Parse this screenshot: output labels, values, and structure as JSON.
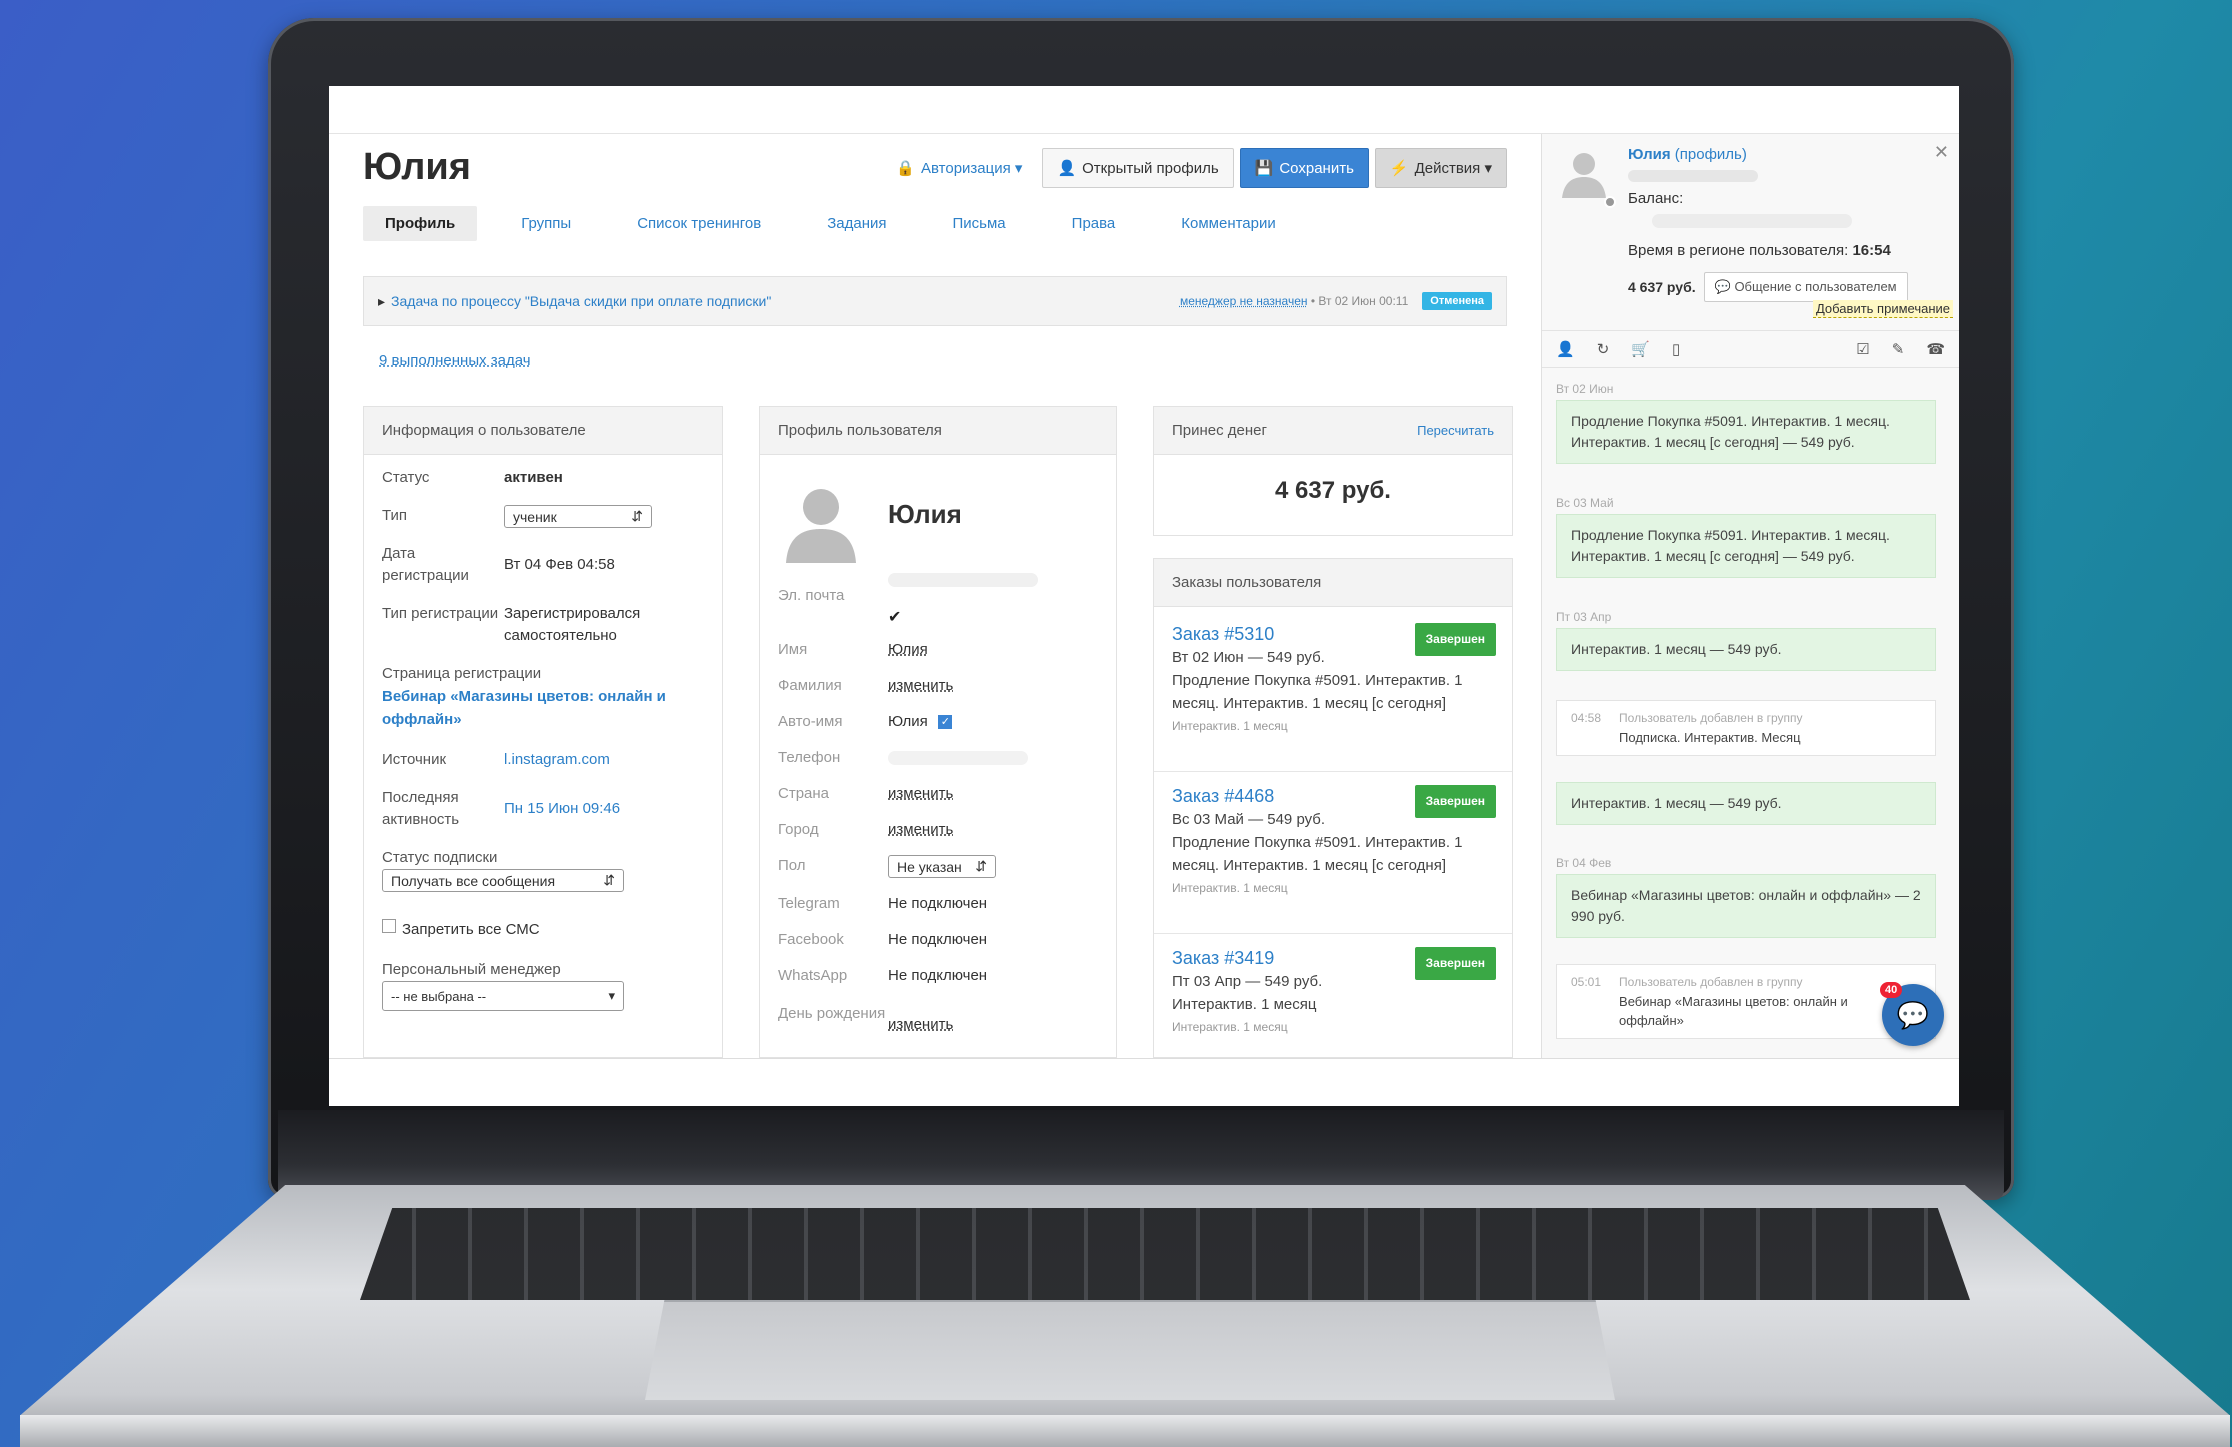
{
  "user": {
    "name": "Юлия"
  },
  "top_actions": {
    "auth": "Авторизация ▾",
    "open_profile": "Открытый профиль",
    "save": "Сохранить",
    "actions": "Действия ▾"
  },
  "tabs": [
    "Профиль",
    "Группы",
    "Список тренингов",
    "Задания",
    "Письма",
    "Права",
    "Комментарии"
  ],
  "task_bar": {
    "text": "Задача по процессу \"Выдача скидки при оплате подписки\"",
    "manager": "менеджер не назначен",
    "date": "• Вт 02 Июн 00:11",
    "status": "Отменена"
  },
  "done_tasks": "9 выполненных задач",
  "user_info": {
    "title": "Информация о пользователе",
    "status_label": "Статус",
    "status": "активен",
    "type_label": "Тип",
    "type": "ученик",
    "reg_date_label": "Дата регистрации",
    "reg_date": "Вт 04 Фев 04:58",
    "reg_type_label": "Тип регистрации",
    "reg_type": "Зарегистрировался самостоятельно",
    "reg_page_label": "Страница регистрации",
    "reg_page": "Вебинар «Магазины цветов: онлайн и оффлайн»",
    "source_label": "Источник",
    "source": "l.instagram.com",
    "last_activity_label": "Последняя активность",
    "last_activity": "Пн 15 Июн 09:46",
    "sub_status_label": "Статус подписки",
    "sub_status": "Получать все сообщения",
    "forbid_sms": "Запретить все СМС",
    "manager_label": "Персональный менеджер",
    "manager": "-- не выбрана --"
  },
  "user_profile": {
    "title": "Профиль пользователя",
    "name": "Юлия",
    "email_label": "Эл. почта",
    "first_name_label": "Имя",
    "first_name": "Юлия",
    "last_name_label": "Фамилия",
    "change": "изменить",
    "auto_name_label": "Авто-имя",
    "auto_name": "Юлия",
    "phone_label": "Телефон",
    "country_label": "Страна",
    "city_label": "Город",
    "gender_label": "Пол",
    "gender": "Не указан",
    "telegram_label": "Telegram",
    "telegram": "Не подключен",
    "facebook_label": "Facebook",
    "facebook": "Не подключен",
    "whatsapp_label": "WhatsApp",
    "whatsapp": "Не подключен",
    "birthday_label": "День рождения"
  },
  "money": {
    "title": "Принес денег",
    "recalc": "Пересчитать",
    "amount": "4 637 руб."
  },
  "orders": {
    "title": "Заказы пользователя",
    "items": [
      {
        "title": "Заказ #5310",
        "status": "Завершен",
        "date_price": "Вт 02 Июн — 549 руб.",
        "desc": "Продление Покупка #5091. Интерактив. 1 месяц. Интерактив. 1 месяц [с сегодня]",
        "sub": "Интерактив. 1 месяц"
      },
      {
        "title": "Заказ #4468",
        "status": "Завершен",
        "date_price": "Вс 03 Май — 549 руб.",
        "desc": "Продление Покупка #5091. Интерактив. 1 месяц. Интерактив. 1 месяц [с сегодня]",
        "sub": "Интерактив. 1 месяц"
      },
      {
        "title": "Заказ #3419",
        "status": "Завершен",
        "date_price": "Пт 03 Апр — 549 руб.",
        "desc": "Интерактив. 1 месяц",
        "sub": "Интерактив. 1 месяц"
      }
    ]
  },
  "side": {
    "name": "Юлия",
    "profile_link": "(профиль)",
    "balance_label": "Баланс:",
    "time_label": "Время в регионе пользователя:",
    "time": "16:54",
    "sum": "4 637 руб.",
    "chat_btn": "Общение с пользователем",
    "add_note": "Добавить примечание",
    "feed": [
      {
        "date": "Вт 02 Июн",
        "kind": "green",
        "text": "Продление Покупка #5091. Интерактив. 1 месяц. Интерактив. 1 месяц [с сегодня] — 549 руб."
      },
      {
        "date": "Вс 03 Май",
        "kind": "green",
        "text": "Продление Покупка #5091. Интерактив. 1 месяц. Интерактив. 1 месяц [с сегодня] — 549 руб."
      },
      {
        "date": "Пт 03 Апр",
        "kind": "green",
        "text": "Интерактив. 1 месяц — 549 руб."
      },
      {
        "kind": "white",
        "time": "04:58",
        "group_label": "Пользователь добавлен в группу",
        "text": "Подписка. Интерактив. Месяц"
      },
      {
        "kind": "green",
        "text": "Интерактив. 1 месяц — 549 руб."
      },
      {
        "date": "Вт 04 Фев",
        "kind": "green",
        "text": "Вебинар «Магазины цветов: онлайн и оффлайн» — 2 990 руб."
      },
      {
        "kind": "white",
        "time": "05:01",
        "group_label": "Пользователь добавлен в группу",
        "text": "Вебинар «Магазины цветов: онлайн и оффлайн»"
      }
    ],
    "chat_count": "40"
  },
  "colors": {
    "accent": "#3a84d4",
    "link": "#2d80c8",
    "success": "#3aa845",
    "info": "#33b5e5"
  }
}
